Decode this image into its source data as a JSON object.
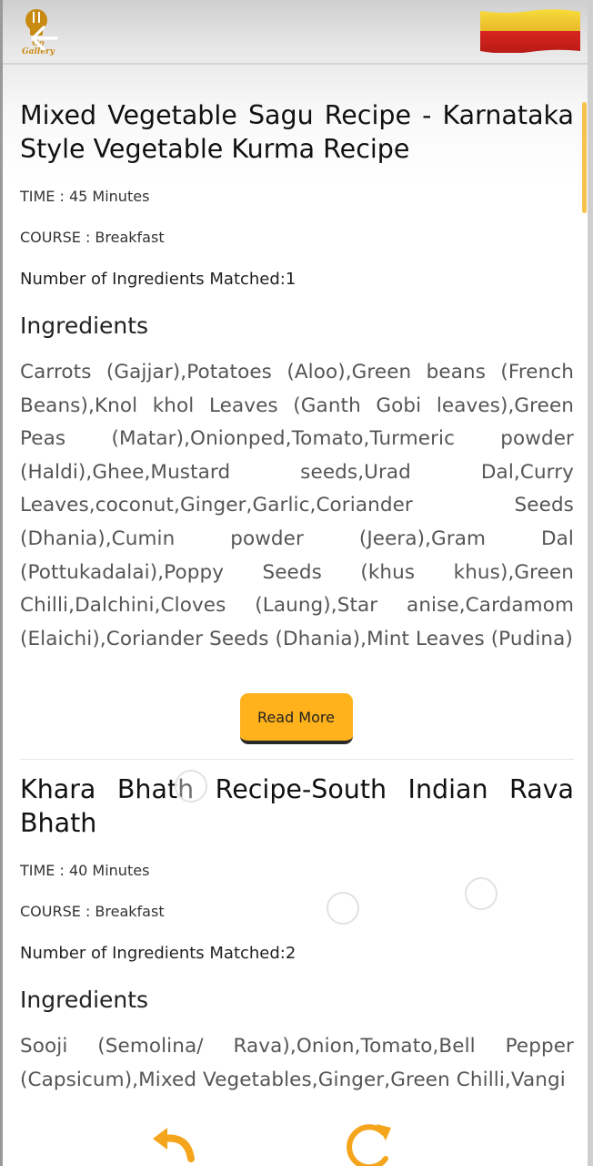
{
  "header": {
    "logo_text_line1": "Co",
    "logo_text_line2": "Gallery",
    "colors": {
      "logo": "#c98a12",
      "flag_top": "#f4d32a",
      "flag_bottom": "#d6251f"
    }
  },
  "recipes": [
    {
      "title": "Mixed Vegetable Sagu Recipe - Karnataka Style Vegetable Kurma Recipe",
      "time": "TIME : 45 Minutes",
      "course": "COURSE : Breakfast",
      "matched": "Number of Ingredients Matched:1",
      "ingredients_heading": "Ingredients",
      "ingredients": "Carrots (Gajjar),Potatoes (Aloo),Green beans (French Beans),Knol khol Leaves (Ganth Gobi leaves),Green Peas (Matar),Onionped,Tomato,Turmeric powder (Haldi),Ghee,Mustard seeds,Urad Dal,Curry Leaves,coconut,Ginger,Garlic,Coriander Seeds (Dhania),Cumin powder (Jeera),Gram Dal (Pottukadalai),Poppy Seeds (khus khus),Green Chilli,Dalchini,Cloves (Laung),Star anise,Cardamom (Elaichi),Coriander Seeds (Dhania),Mint Leaves (Pudina)",
      "read_more_label": "Read More"
    },
    {
      "title": "Khara Bhath Recipe-South Indian Rava Bhath",
      "time": "TIME : 40 Minutes",
      "course": "COURSE : Breakfast",
      "matched": "Number of Ingredients Matched:2",
      "ingredients_heading": "Ingredients",
      "ingredients": "Sooji (Semolina/ Rava),Onion,Tomato,Bell Pepper (Capsicum),Mixed Vegetables,Ginger,Green Chilli,Vangi"
    }
  ],
  "accent_color": "#ffb21c"
}
